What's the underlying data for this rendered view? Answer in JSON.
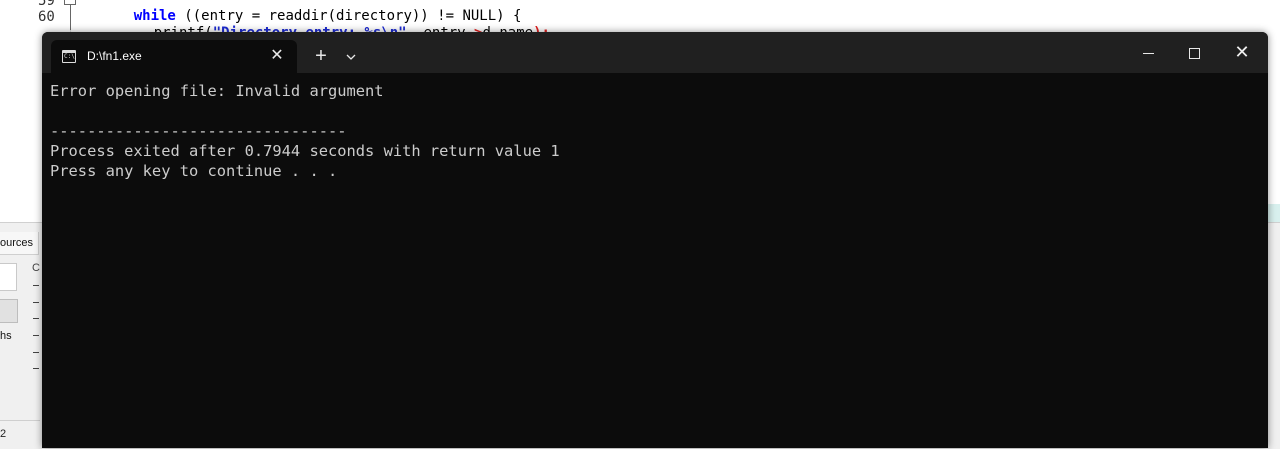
{
  "ide": {
    "editor": {
      "line_number": "60",
      "printf_fn": "printf(",
      "printf_string": "\"Directory entry: %s\\n\"",
      "printf_comma": ", entry",
      "printf_arrow": "->",
      "printf_member": "d_name",
      "printf_close": ");"
    },
    "bottom_panel": {
      "resources_tab": "ources",
      "side_label": "hs",
      "column_letter": "C",
      "status_number": "2"
    }
  },
  "terminal": {
    "tab": {
      "title": "D:\\fn1.exe",
      "icon": "console-app-icon",
      "close_icon": "close-icon"
    },
    "new_tab_glyph": "+",
    "dropdown_glyph": "⌄",
    "window_controls": {
      "close_glyph": "✕"
    },
    "output_lines": [
      "Error opening file: Invalid argument",
      "",
      "--------------------------------",
      "Process exited after 0.7944 seconds with return value 1",
      "Press any key to continue . . ."
    ],
    "colors": {
      "background": "#0c0c0c",
      "titlebar": "#202020",
      "text": "#cccccc"
    }
  }
}
